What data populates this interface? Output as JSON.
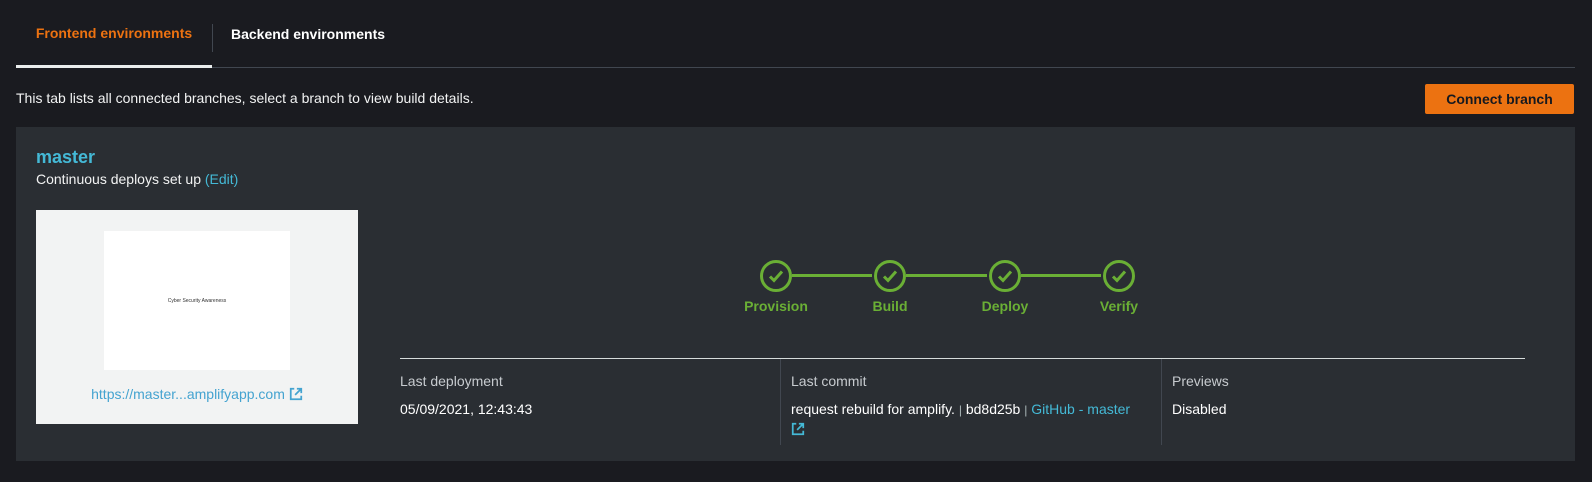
{
  "tabs": {
    "frontend": "Frontend environments",
    "backend": "Backend environments"
  },
  "intro_text": "This tab lists all connected branches, select a branch to view build details.",
  "connect_branch_label": "Connect branch",
  "branch": {
    "name": "master",
    "cd_text": "Continuous deploys set up",
    "edit_label": "(Edit)",
    "thumbnail_text": "Cyber Security Awareness",
    "url": "https://master...amplifyapp.com"
  },
  "pipeline": {
    "steps": [
      "Provision",
      "Build",
      "Deploy",
      "Verify"
    ],
    "status": "succeeded",
    "color": "#6aaf35"
  },
  "info": {
    "last_deployment": {
      "label": "Last deployment",
      "value": "05/09/2021, 12:43:43"
    },
    "last_commit": {
      "label": "Last commit",
      "message": "request rebuild for amplify.",
      "sep": "|",
      "hash": "bd8d25b",
      "repo_link": "GitHub - master"
    },
    "previews": {
      "label": "Previews",
      "value": "Disabled"
    }
  },
  "colors": {
    "accent": "#ec7211",
    "link": "#44b9d6",
    "success": "#6aaf35",
    "background": "#1a1b20",
    "panel": "#2a2e33"
  }
}
